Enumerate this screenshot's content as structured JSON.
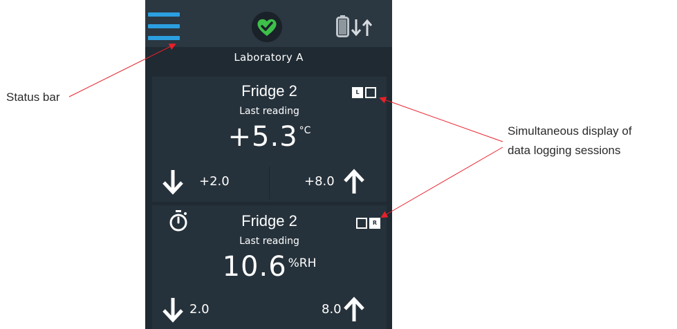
{
  "annotations": {
    "status_bar": "Status bar",
    "simultaneous_line1": "Simultaneous display of",
    "simultaneous_line2": "data logging sessions"
  },
  "status_bar": {
    "menu_icon": "hamburger-menu-icon",
    "health_icon": "heart-check-icon",
    "battery_icon": "battery-icon",
    "sync_icon": "down-up-arrows-icon"
  },
  "location": "Laboratory A",
  "cards": [
    {
      "title": "Fridge 2",
      "subtitle": "Last reading",
      "value": "+5.3",
      "unit": "°C",
      "low": "+2.0",
      "high": "+8.0",
      "session_badges": [
        "L",
        ""
      ]
    },
    {
      "title": "Fridge 2",
      "subtitle": "Last reading",
      "value": "10.6",
      "unit": "%RH",
      "low": "2.0",
      "high": "8.0",
      "session_badges": [
        "",
        "R"
      ],
      "timer_icon": "stopwatch-icon"
    }
  ],
  "colors": {
    "screen_bg": "#1f2a33",
    "status_bar_bg": "#2b3741",
    "card_bg": "#26323b",
    "accent_blue": "#2b9fe0",
    "health_green": "#3dbf4a",
    "annotation_red": "#e8202a"
  }
}
